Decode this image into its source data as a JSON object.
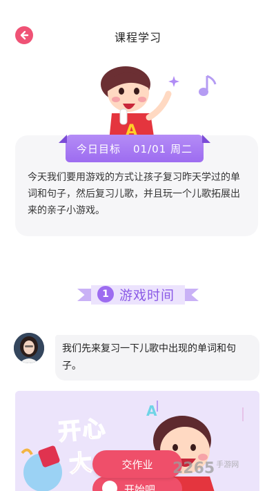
{
  "header": {
    "title": "课程学习",
    "back_icon": "arrow-left-icon",
    "accent": "#ef5275"
  },
  "goal": {
    "label": "今日目标",
    "date": "01/01 周二",
    "text": "今天我们要用游戏的方式让孩子复习昨天学过的单词和句子，然后复习儿歌，并且玩一个儿歌拓展出来的亲子小游戏。"
  },
  "section": {
    "number": "1",
    "title": "游戏时间",
    "color": "#9d6cf0"
  },
  "chat": {
    "message": "我们先来复习一下儿歌中出现的单词和句子。"
  },
  "video": {
    "title_line1": "开心",
    "title_line2": "大"
  },
  "actions": {
    "submit_label": "交作业",
    "start_label": "开始吧"
  },
  "watermark": {
    "text": "2265",
    "sub": "手游网"
  }
}
